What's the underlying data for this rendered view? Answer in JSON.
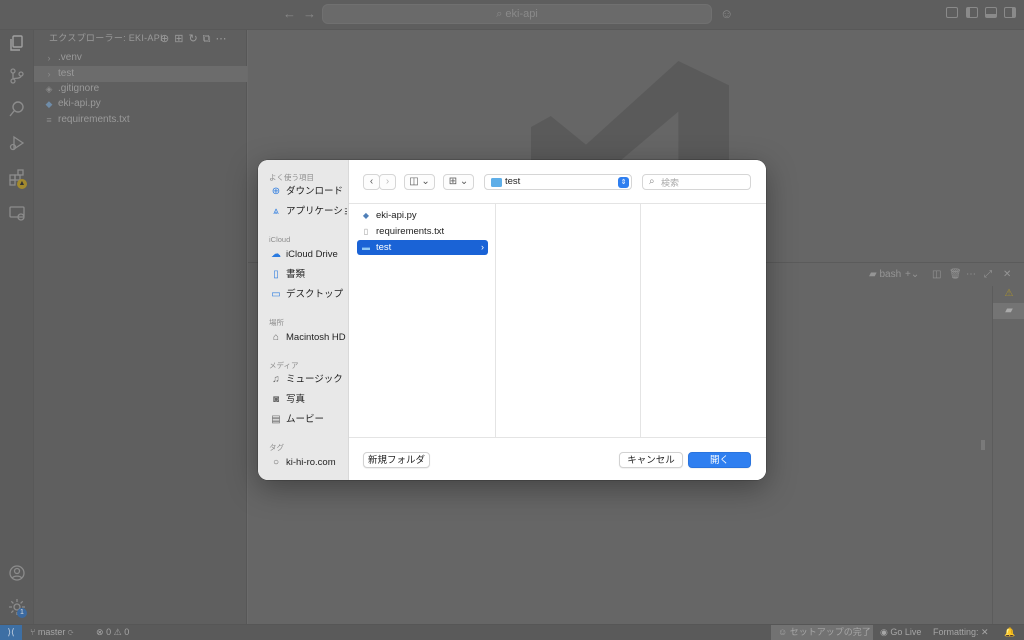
{
  "titlebar": {
    "search_text": "eki-api",
    "back_icon": "arrow-left-icon",
    "forward_icon": "arrow-right-icon"
  },
  "activity_bar": {
    "icons": [
      "files-icon",
      "source-control-icon",
      "search-icon",
      "run-debug-icon",
      "extensions-icon",
      "remote-explorer-icon"
    ],
    "bottom_icons": [
      "account-icon",
      "settings-gear-icon"
    ],
    "settings_badge": "1"
  },
  "explorer": {
    "title": "エクスプローラー: EKI-API",
    "items": [
      {
        "label": ".venv",
        "type": "folder"
      },
      {
        "label": "test",
        "type": "folder"
      },
      {
        "label": ".gitignore",
        "type": "file"
      },
      {
        "label": "eki-api.py",
        "type": "file"
      },
      {
        "label": "requirements.txt",
        "type": "file"
      }
    ]
  },
  "panel": {
    "terminal_label": "bash"
  },
  "statusbar": {
    "branch": "master",
    "errors": "0",
    "warnings": "0",
    "setup": "セットアップの完了",
    "golive": "Go Live",
    "formatting": "Formatting: ✕"
  },
  "dialog": {
    "sidebar": {
      "favorites_title": "よく使う項目",
      "favorites": [
        {
          "label": "ダウンロード",
          "icon": "download-icon"
        },
        {
          "label": "アプリケーション",
          "icon": "applications-icon"
        }
      ],
      "icloud_title": "iCloud",
      "icloud": [
        {
          "label": "iCloud Drive",
          "icon": "cloud-icon"
        },
        {
          "label": "書類",
          "icon": "document-icon"
        },
        {
          "label": "デスクトップ",
          "icon": "desktop-icon"
        }
      ],
      "locations_title": "場所",
      "locations": [
        {
          "label": "Macintosh HD",
          "icon": "disk-icon"
        }
      ],
      "media_title": "メディア",
      "media": [
        {
          "label": "ミュージック",
          "icon": "music-icon"
        },
        {
          "label": "写真",
          "icon": "photo-icon"
        },
        {
          "label": "ムービー",
          "icon": "movie-icon"
        }
      ],
      "tags_title": "タグ",
      "tags": [
        {
          "label": "ki-hi-ro.com",
          "icon": "tag-circle-icon"
        }
      ]
    },
    "path": "test",
    "search_placeholder": "検索",
    "files": [
      {
        "label": "eki-api.py",
        "icon": "python-file-icon",
        "selected": false
      },
      {
        "label": "requirements.txt",
        "icon": "text-file-icon",
        "selected": false
      },
      {
        "label": "test",
        "icon": "folder-icon",
        "selected": true
      }
    ],
    "new_folder_label": "新規フォルダ",
    "cancel_label": "キャンセル",
    "open_label": "開く",
    "accent_color": "#2f7ff0",
    "selection_color": "#1a63d6"
  }
}
